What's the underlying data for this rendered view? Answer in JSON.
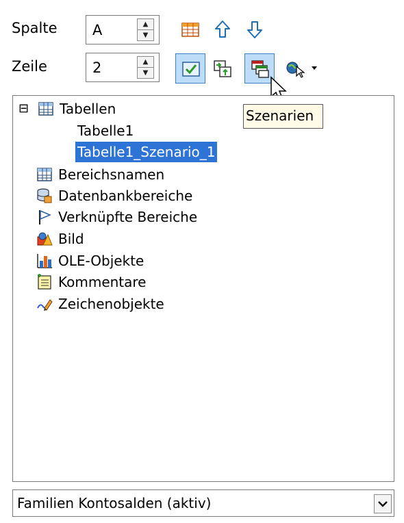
{
  "navigator": {
    "column": {
      "label": "Spalte",
      "value": "A"
    },
    "row": {
      "label": "Zeile",
      "value": "2"
    },
    "tooltip": "Szenarien",
    "tree": {
      "root": {
        "label": "Tabellen",
        "expanded": true,
        "toggle": "⊟"
      },
      "sheets": [
        {
          "label": "Tabelle1"
        },
        {
          "label": "Tabelle1_Szenario_1",
          "selected": true
        }
      ],
      "categories": [
        {
          "label": "Bereichsnamen",
          "icon": "range-names-icon"
        },
        {
          "label": "Datenbankbereiche",
          "icon": "database-icon"
        },
        {
          "label": "Verknüpfte Bereiche",
          "icon": "flag-icon"
        },
        {
          "label": "Bild",
          "icon": "image-icon"
        },
        {
          "label": "OLE-Objekte",
          "icon": "chart-icon"
        },
        {
          "label": "Kommentare",
          "icon": "comment-icon"
        },
        {
          "label": "Zeichenobjekte",
          "icon": "drawing-icon"
        }
      ]
    },
    "document_select": {
      "value": "Familien Kontosalden (aktiv)"
    }
  },
  "colors": {
    "selection": "#2d74d6",
    "toggle_active": "#bcdcf8",
    "tooltip_bg": "#fffbe6"
  }
}
